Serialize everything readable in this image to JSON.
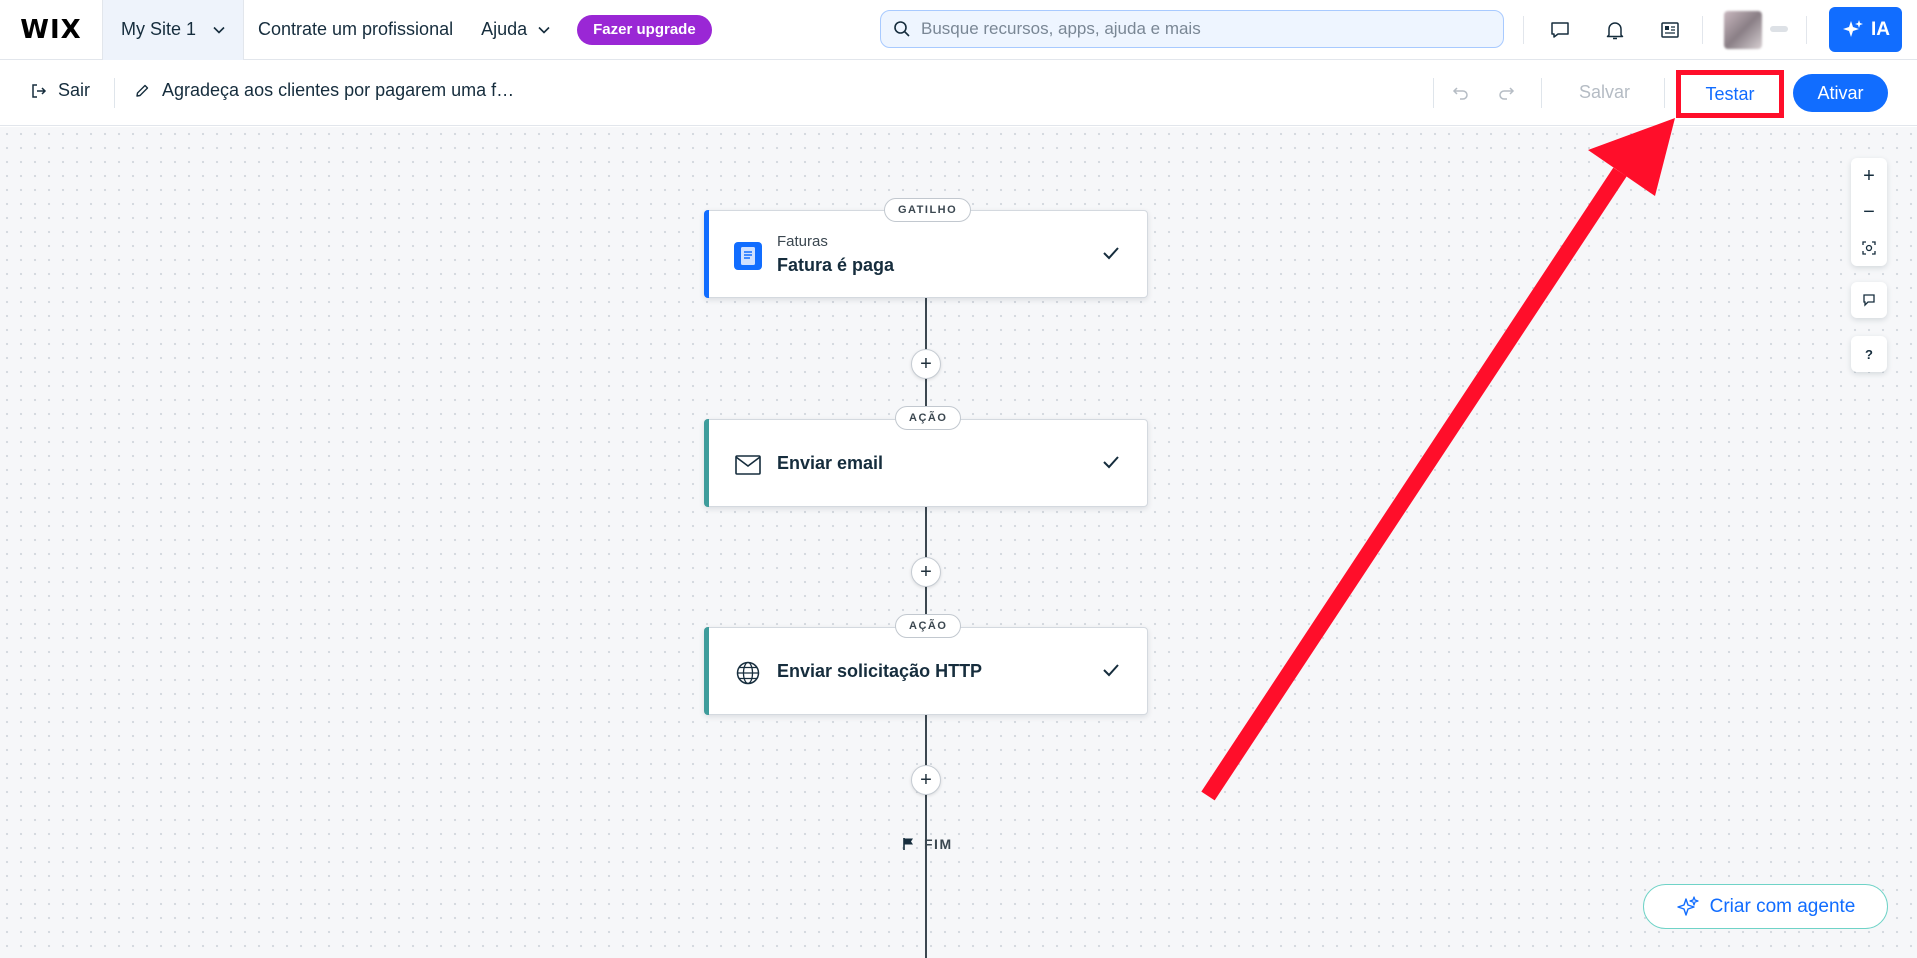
{
  "topbar": {
    "logo": "WIX",
    "site_name": "My Site 1",
    "hire_link": "Contrate um profissional",
    "help_link": "Ajuda",
    "upgrade_label": "Fazer upgrade",
    "search_placeholder": "Busque recursos, apps, ajuda e mais",
    "ai_label": "IA"
  },
  "toolbar": {
    "exit_label": "Sair",
    "automation_name": "Agradeça aos clientes por pagarem uma f…",
    "save_label": "Salvar",
    "test_label": "Testar",
    "activate_label": "Ativar"
  },
  "flow": {
    "trigger": {
      "pill": "GATILHO",
      "app": "Faturas",
      "title": "Fatura é paga"
    },
    "actions": [
      {
        "pill": "AÇÃO",
        "title": "Enviar email"
      },
      {
        "pill": "AÇÃO",
        "title": "Enviar solicitação HTTP"
      }
    ],
    "end_label": "FIM"
  },
  "canvas_controls": {
    "zoom_in": "+",
    "zoom_out": "−",
    "help": "?"
  },
  "agent_button": {
    "label": "Criar com agente"
  },
  "colors": {
    "brand_blue": "#116dff",
    "upgrade_purple": "#9a27d5",
    "trigger_bar": "#116dff",
    "action_bar": "#3e9c9b",
    "annotation_red": "#ff0e2a"
  }
}
